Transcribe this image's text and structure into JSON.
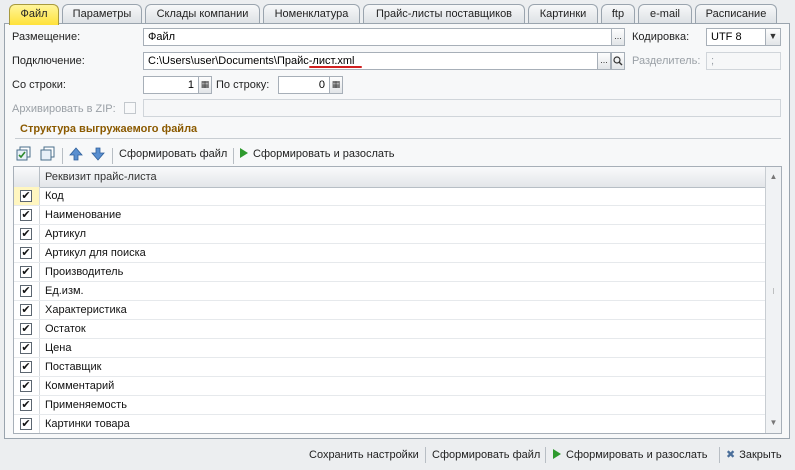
{
  "tabs": [
    {
      "label": "Файл",
      "active": true
    },
    {
      "label": "Параметры"
    },
    {
      "label": "Склады компании"
    },
    {
      "label": "Номенклатура"
    },
    {
      "label": "Прайс-листы поставщиков"
    },
    {
      "label": "Картинки"
    },
    {
      "label": "ftp"
    },
    {
      "label": "e-mail"
    },
    {
      "label": "Расписание"
    }
  ],
  "form": {
    "placement_label": "Размещение:",
    "placement_value": "Файл",
    "encoding_label": "Кодировка:",
    "encoding_value": "UTF 8",
    "connection_label": "Подключение:",
    "connection_value": "C:\\Users\\user\\Documents\\Прайс-лист.xml",
    "separator_label": "Разделитель:",
    "separator_value": ";",
    "from_row_label": "Со строки:",
    "from_row_value": "1",
    "to_row_label": "По строку:",
    "to_row_value": "0",
    "archive_label": "Архивировать в ZIP:"
  },
  "section": {
    "title": "Структура выгружаемого файла",
    "form_file": "Сформировать файл",
    "form_and_send": "Сформировать и разослать"
  },
  "grid": {
    "header": "Реквизит прайс-листа",
    "rows": [
      "Код",
      "Наименование",
      "Артикул",
      "Артикул для поиска",
      "Производитель",
      "Ед.изм.",
      "Характеристика",
      "Остаток",
      "Цена",
      "Поставщик",
      "Комментарий",
      "Применяемость",
      "Картинки товара"
    ]
  },
  "bottom": {
    "save": "Сохранить настройки",
    "form_file": "Сформировать файл",
    "form_and_send": "Сформировать и разослать",
    "close": "Закрыть"
  }
}
